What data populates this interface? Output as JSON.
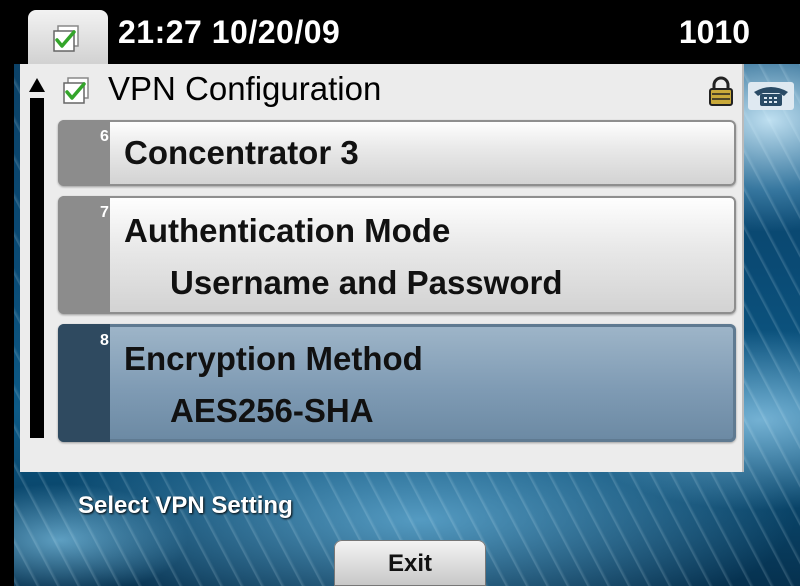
{
  "status_bar": {
    "datetime": "21:27 10/20/09",
    "line_number": "1010"
  },
  "panel": {
    "title": "VPN Configuration",
    "items": [
      {
        "number": "6",
        "label": "Concentrator 3",
        "value": ""
      },
      {
        "number": "7",
        "label": "Authentication Mode",
        "value": "Username and Password"
      },
      {
        "number": "8",
        "label": "Encryption Method",
        "value": "AES256-SHA"
      }
    ],
    "selected_index": 2
  },
  "footer": {
    "hint": "Select VPN Setting",
    "softkeys": [
      {
        "label": "Exit"
      }
    ]
  },
  "icons": {
    "app": "checkbox-icon",
    "lock": "lock-icon",
    "line": "phone-line-icon",
    "scroll": "scroll-up-arrow-icon"
  },
  "colors": {
    "selected_row": "#7f9bb4",
    "row_strip": "#8c8c8c",
    "check_green": "#33a52a"
  }
}
